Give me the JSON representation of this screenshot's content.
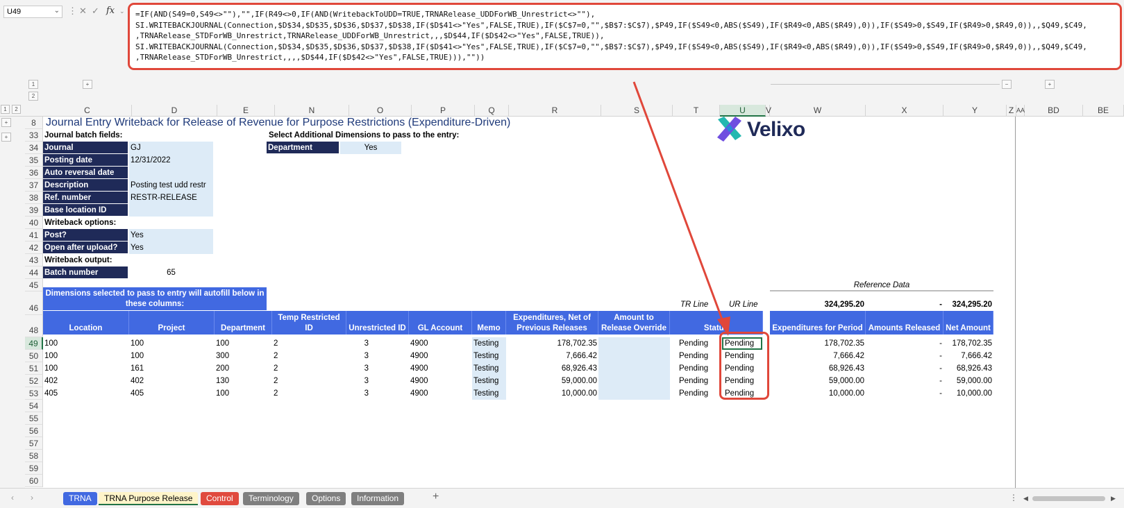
{
  "formula_bar": {
    "name_box": "U49",
    "fx": "fx",
    "lines": [
      "=IF(AND(S49=0,S49<>\"\"),\"\",IF(R49<>0,IF(AND(WritebackToUDD=TRUE,TRNARelease_UDDForWB_Unrestrict<>\"\"),",
      "SI.WRITEBACKJOURNAL(Connection,$D$34,$D$35,$D$36,$D$37,$D$38,IF($D$41<>\"Yes\",FALSE,TRUE),IF($C$7=0,\"\",$B$7:$C$7),$P49,IF($S49<0,ABS($S49),IF($R49<0,ABS($R49),0)),IF($S49>0,$S49,IF($R49>0,$R49,0)),,$Q49,$C49,",
      ",TRNARelease_STDForWB_Unrestrict,TRNARelease_UDDForWB_Unrestrict,,,$D$44,IF($D$42<>\"Yes\",FALSE,TRUE)),",
      "SI.WRITEBACKJOURNAL(Connection,$D$34,$D$35,$D$36,$D$37,$D$38,IF($D$41<>\"Yes\",FALSE,TRUE),IF($C$7=0,\"\",$B$7:$C$7),$P49,IF($S49<0,ABS($S49),IF($R49<0,ABS($R49),0)),IF($S49>0,$S49,IF($R49>0,$R49,0)),,$Q49,$C49,",
      ",TRNARelease_STDForWB_Unrestrict,,,,$D$44,IF($D$42<>\"Yes\",FALSE,TRUE))),\"\"))"
    ]
  },
  "outline": {
    "levels": [
      "1",
      "2"
    ],
    "plus": "+",
    "minus": "−"
  },
  "columns": [
    "C",
    "D",
    "E",
    "N",
    "O",
    "P",
    "Q",
    "R",
    "S",
    "T",
    "U",
    "V",
    "W",
    "X",
    "Y",
    "Z",
    "AA",
    "BD",
    "BE"
  ],
  "rows": [
    "8",
    "33",
    "34",
    "35",
    "36",
    "37",
    "38",
    "39",
    "40",
    "41",
    "42",
    "43",
    "44",
    "45",
    "46",
    "48",
    "49",
    "50",
    "51",
    "52",
    "53",
    "54",
    "55",
    "56",
    "57",
    "58",
    "59",
    "60"
  ],
  "sheet": {
    "title": "Journal Entry Writeback for Release of Revenue for Purpose Restrictions (Expenditure-Driven)",
    "logo_text": "Velixo",
    "batch_fields_heading": "Journal batch fields:",
    "fields": [
      {
        "label": "Journal",
        "value": "GJ"
      },
      {
        "label": "Posting date",
        "value": "12/31/2022"
      },
      {
        "label": "Auto reversal date",
        "value": ""
      },
      {
        "label": "Description",
        "value": "Posting test udd restr"
      },
      {
        "label": "Ref. number",
        "value": "RESTR-RELEASE"
      },
      {
        "label": "Base location ID",
        "value": ""
      }
    ],
    "writeback_options_heading": "Writeback options:",
    "options": [
      {
        "label": "Post?",
        "value": "Yes"
      },
      {
        "label": "Open after upload?",
        "value": "Yes"
      }
    ],
    "writeback_output_heading": "Writeback output:",
    "batch_number_label": "Batch number",
    "batch_number_value": "65",
    "dims_heading": "Select Additional Dimensions to pass to the entry:",
    "dims": {
      "label": "Department",
      "value": "Yes"
    },
    "autofill_note": "Dimensions selected to pass to entry will autofill below in these columns:",
    "tr_line": "TR Line",
    "ur_line": "UR Line",
    "reference_data": "Reference Data",
    "totals": {
      "expenditures": "324,295.20",
      "released": "-",
      "net": "324,295.20"
    },
    "headers": [
      "Location",
      "Project",
      "Department",
      "Temp Restricted ID",
      "Unrestricted ID",
      "GL Account",
      "Memo",
      "Expenditures, Net of Previous Releases",
      "Amount to Release Override",
      "Status",
      "Expenditures for Period",
      "Amounts Released",
      "Net Amount"
    ],
    "data_rows": [
      {
        "location": "100",
        "project": "100",
        "department": "100",
        "tr_id": "2",
        "ur_id": "3",
        "gl": "4900",
        "memo": "Testing",
        "exp": "178,702.35",
        "override": "",
        "tr_status": "Pending",
        "ur_status": "Pending",
        "exp_period": "178,702.35",
        "released": "-",
        "net": "178,702.35"
      },
      {
        "location": "100",
        "project": "100",
        "department": "300",
        "tr_id": "2",
        "ur_id": "3",
        "gl": "4900",
        "memo": "Testing",
        "exp": "7,666.42",
        "override": "",
        "tr_status": "Pending",
        "ur_status": "Pending",
        "exp_period": "7,666.42",
        "released": "-",
        "net": "7,666.42"
      },
      {
        "location": "100",
        "project": "161",
        "department": "200",
        "tr_id": "2",
        "ur_id": "3",
        "gl": "4900",
        "memo": "Testing",
        "exp": "68,926.43",
        "override": "",
        "tr_status": "Pending",
        "ur_status": "Pending",
        "exp_period": "68,926.43",
        "released": "-",
        "net": "68,926.43"
      },
      {
        "location": "402",
        "project": "402",
        "department": "130",
        "tr_id": "2",
        "ur_id": "3",
        "gl": "4900",
        "memo": "Testing",
        "exp": "59,000.00",
        "override": "",
        "tr_status": "Pending",
        "ur_status": "Pending",
        "exp_period": "59,000.00",
        "released": "-",
        "net": "59,000.00"
      },
      {
        "location": "405",
        "project": "405",
        "department": "100",
        "tr_id": "2",
        "ur_id": "3",
        "gl": "4900",
        "memo": "Testing",
        "exp": "10,000.00",
        "override": "",
        "tr_status": "Pending",
        "ur_status": "Pending",
        "exp_period": "10,000.00",
        "released": "-",
        "net": "10,000.00"
      }
    ]
  },
  "tabs": [
    {
      "label": "TRNA",
      "bg": "#4169e1",
      "fg": "#ffffff"
    },
    {
      "label": "TRNA Purpose Release",
      "bg": "#fff4c9",
      "fg": "#000000",
      "active": true
    },
    {
      "label": "Control",
      "bg": "#e04a3e",
      "fg": "#ffffff"
    },
    {
      "label": "Terminology",
      "bg": "#7f7f7f",
      "fg": "#ffffff"
    },
    {
      "label": "Options",
      "bg": "#7f7f7f",
      "fg": "#ffffff"
    },
    {
      "label": "Information",
      "bg": "#7f7f7f",
      "fg": "#ffffff"
    }
  ],
  "tab_add": "+",
  "colors": {
    "accent": "#e0473a",
    "header_blue": "#4169e1",
    "navy": "#1f2a58",
    "input_bg": "#ddebf7"
  }
}
